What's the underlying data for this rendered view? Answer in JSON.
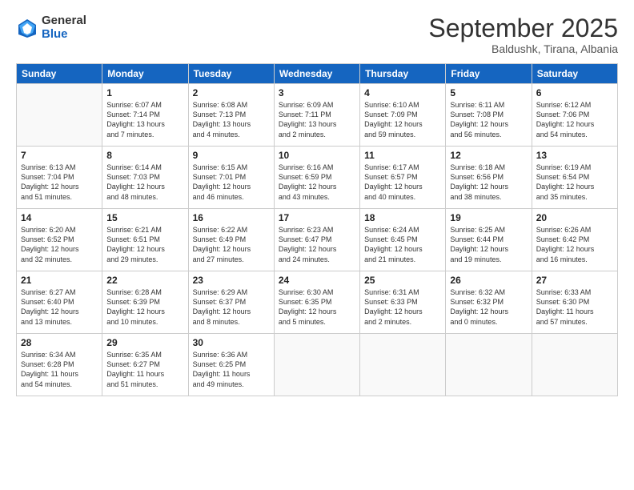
{
  "logo": {
    "general": "General",
    "blue": "Blue"
  },
  "header": {
    "month": "September 2025",
    "location": "Baldushk, Tirana, Albania"
  },
  "weekdays": [
    "Sunday",
    "Monday",
    "Tuesday",
    "Wednesday",
    "Thursday",
    "Friday",
    "Saturday"
  ],
  "weeks": [
    [
      {
        "day": "",
        "info": ""
      },
      {
        "day": "1",
        "info": "Sunrise: 6:07 AM\nSunset: 7:14 PM\nDaylight: 13 hours\nand 7 minutes."
      },
      {
        "day": "2",
        "info": "Sunrise: 6:08 AM\nSunset: 7:13 PM\nDaylight: 13 hours\nand 4 minutes."
      },
      {
        "day": "3",
        "info": "Sunrise: 6:09 AM\nSunset: 7:11 PM\nDaylight: 13 hours\nand 2 minutes."
      },
      {
        "day": "4",
        "info": "Sunrise: 6:10 AM\nSunset: 7:09 PM\nDaylight: 12 hours\nand 59 minutes."
      },
      {
        "day": "5",
        "info": "Sunrise: 6:11 AM\nSunset: 7:08 PM\nDaylight: 12 hours\nand 56 minutes."
      },
      {
        "day": "6",
        "info": "Sunrise: 6:12 AM\nSunset: 7:06 PM\nDaylight: 12 hours\nand 54 minutes."
      }
    ],
    [
      {
        "day": "7",
        "info": "Sunrise: 6:13 AM\nSunset: 7:04 PM\nDaylight: 12 hours\nand 51 minutes."
      },
      {
        "day": "8",
        "info": "Sunrise: 6:14 AM\nSunset: 7:03 PM\nDaylight: 12 hours\nand 48 minutes."
      },
      {
        "day": "9",
        "info": "Sunrise: 6:15 AM\nSunset: 7:01 PM\nDaylight: 12 hours\nand 46 minutes."
      },
      {
        "day": "10",
        "info": "Sunrise: 6:16 AM\nSunset: 6:59 PM\nDaylight: 12 hours\nand 43 minutes."
      },
      {
        "day": "11",
        "info": "Sunrise: 6:17 AM\nSunset: 6:57 PM\nDaylight: 12 hours\nand 40 minutes."
      },
      {
        "day": "12",
        "info": "Sunrise: 6:18 AM\nSunset: 6:56 PM\nDaylight: 12 hours\nand 38 minutes."
      },
      {
        "day": "13",
        "info": "Sunrise: 6:19 AM\nSunset: 6:54 PM\nDaylight: 12 hours\nand 35 minutes."
      }
    ],
    [
      {
        "day": "14",
        "info": "Sunrise: 6:20 AM\nSunset: 6:52 PM\nDaylight: 12 hours\nand 32 minutes."
      },
      {
        "day": "15",
        "info": "Sunrise: 6:21 AM\nSunset: 6:51 PM\nDaylight: 12 hours\nand 29 minutes."
      },
      {
        "day": "16",
        "info": "Sunrise: 6:22 AM\nSunset: 6:49 PM\nDaylight: 12 hours\nand 27 minutes."
      },
      {
        "day": "17",
        "info": "Sunrise: 6:23 AM\nSunset: 6:47 PM\nDaylight: 12 hours\nand 24 minutes."
      },
      {
        "day": "18",
        "info": "Sunrise: 6:24 AM\nSunset: 6:45 PM\nDaylight: 12 hours\nand 21 minutes."
      },
      {
        "day": "19",
        "info": "Sunrise: 6:25 AM\nSunset: 6:44 PM\nDaylight: 12 hours\nand 19 minutes."
      },
      {
        "day": "20",
        "info": "Sunrise: 6:26 AM\nSunset: 6:42 PM\nDaylight: 12 hours\nand 16 minutes."
      }
    ],
    [
      {
        "day": "21",
        "info": "Sunrise: 6:27 AM\nSunset: 6:40 PM\nDaylight: 12 hours\nand 13 minutes."
      },
      {
        "day": "22",
        "info": "Sunrise: 6:28 AM\nSunset: 6:39 PM\nDaylight: 12 hours\nand 10 minutes."
      },
      {
        "day": "23",
        "info": "Sunrise: 6:29 AM\nSunset: 6:37 PM\nDaylight: 12 hours\nand 8 minutes."
      },
      {
        "day": "24",
        "info": "Sunrise: 6:30 AM\nSunset: 6:35 PM\nDaylight: 12 hours\nand 5 minutes."
      },
      {
        "day": "25",
        "info": "Sunrise: 6:31 AM\nSunset: 6:33 PM\nDaylight: 12 hours\nand 2 minutes."
      },
      {
        "day": "26",
        "info": "Sunrise: 6:32 AM\nSunset: 6:32 PM\nDaylight: 12 hours\nand 0 minutes."
      },
      {
        "day": "27",
        "info": "Sunrise: 6:33 AM\nSunset: 6:30 PM\nDaylight: 11 hours\nand 57 minutes."
      }
    ],
    [
      {
        "day": "28",
        "info": "Sunrise: 6:34 AM\nSunset: 6:28 PM\nDaylight: 11 hours\nand 54 minutes."
      },
      {
        "day": "29",
        "info": "Sunrise: 6:35 AM\nSunset: 6:27 PM\nDaylight: 11 hours\nand 51 minutes."
      },
      {
        "day": "30",
        "info": "Sunrise: 6:36 AM\nSunset: 6:25 PM\nDaylight: 11 hours\nand 49 minutes."
      },
      {
        "day": "",
        "info": ""
      },
      {
        "day": "",
        "info": ""
      },
      {
        "day": "",
        "info": ""
      },
      {
        "day": "",
        "info": ""
      }
    ]
  ]
}
